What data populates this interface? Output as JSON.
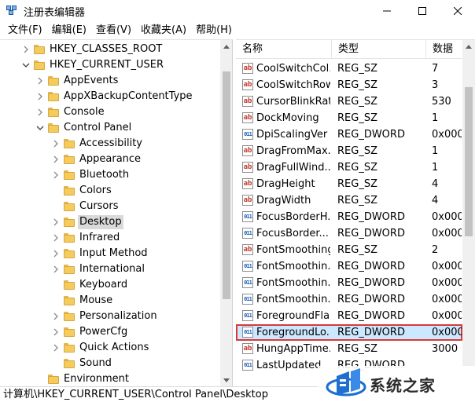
{
  "window": {
    "title": "注册表编辑器",
    "controls": [
      "minimize-icon",
      "maximize-icon",
      "close-icon"
    ]
  },
  "menu": [
    "文件(F)",
    "编辑(E)",
    "查看(V)",
    "收藏夹(A)",
    "帮助(H)"
  ],
  "tree": {
    "items": [
      {
        "label": "HKEY_CLASSES_ROOT",
        "level": 1,
        "expander": "collapsed"
      },
      {
        "label": "HKEY_CURRENT_USER",
        "level": 1,
        "expander": "expanded"
      },
      {
        "label": "AppEvents",
        "level": 2,
        "expander": "collapsed"
      },
      {
        "label": "AppXBackupContentType",
        "level": 2,
        "expander": "collapsed"
      },
      {
        "label": "Console",
        "level": 2,
        "expander": "collapsed"
      },
      {
        "label": "Control Panel",
        "level": 2,
        "expander": "expanded"
      },
      {
        "label": "Accessibility",
        "level": 3,
        "expander": "collapsed"
      },
      {
        "label": "Appearance",
        "level": 3,
        "expander": "collapsed"
      },
      {
        "label": "Bluetooth",
        "level": 3,
        "expander": "collapsed"
      },
      {
        "label": "Colors",
        "level": 3,
        "expander": "none"
      },
      {
        "label": "Cursors",
        "level": 3,
        "expander": "none"
      },
      {
        "label": "Desktop",
        "level": 3,
        "expander": "collapsed",
        "selected": true
      },
      {
        "label": "Infrared",
        "level": 3,
        "expander": "collapsed"
      },
      {
        "label": "Input Method",
        "level": 3,
        "expander": "collapsed"
      },
      {
        "label": "International",
        "level": 3,
        "expander": "collapsed"
      },
      {
        "label": "Keyboard",
        "level": 3,
        "expander": "none"
      },
      {
        "label": "Mouse",
        "level": 3,
        "expander": "none"
      },
      {
        "label": "Personalization",
        "level": 3,
        "expander": "collapsed"
      },
      {
        "label": "PowerCfg",
        "level": 3,
        "expander": "collapsed"
      },
      {
        "label": "Quick Actions",
        "level": 3,
        "expander": "collapsed"
      },
      {
        "label": "Sound",
        "level": 3,
        "expander": "none"
      },
      {
        "label": "Environment",
        "level": 2,
        "expander": "none"
      }
    ]
  },
  "list": {
    "columns": [
      "名称",
      "类型",
      "数据"
    ],
    "rows": [
      {
        "name": "CoolSwitchCol...",
        "type": "REG_SZ",
        "data": "7",
        "icon": "string-value-icon"
      },
      {
        "name": "CoolSwitchRows",
        "type": "REG_SZ",
        "data": "3",
        "icon": "string-value-icon"
      },
      {
        "name": "CursorBlinkRate",
        "type": "REG_SZ",
        "data": "530",
        "icon": "string-value-icon"
      },
      {
        "name": "DockMoving",
        "type": "REG_SZ",
        "data": "1",
        "icon": "string-value-icon"
      },
      {
        "name": "DpiScalingVer",
        "type": "REG_DWORD",
        "data": "0x000",
        "icon": "dword-value-icon"
      },
      {
        "name": "DragFromMax...",
        "type": "REG_SZ",
        "data": "1",
        "icon": "string-value-icon"
      },
      {
        "name": "DragFullWind...",
        "type": "REG_SZ",
        "data": "1",
        "icon": "string-value-icon"
      },
      {
        "name": "DragHeight",
        "type": "REG_SZ",
        "data": "4",
        "icon": "string-value-icon"
      },
      {
        "name": "DragWidth",
        "type": "REG_SZ",
        "data": "4",
        "icon": "string-value-icon"
      },
      {
        "name": "FocusBorderH...",
        "type": "REG_DWORD",
        "data": "0x000",
        "icon": "dword-value-icon"
      },
      {
        "name": "FocusBorder...",
        "type": "REG_DWORD",
        "data": "0x000",
        "icon": "dword-value-icon"
      },
      {
        "name": "FontSmoothing",
        "type": "REG_SZ",
        "data": "2",
        "icon": "string-value-icon"
      },
      {
        "name": "FontSmoothin...",
        "type": "REG_DWORD",
        "data": "0x000",
        "icon": "dword-value-icon"
      },
      {
        "name": "FontSmoothin...",
        "type": "REG_DWORD",
        "data": "0x000",
        "icon": "dword-value-icon"
      },
      {
        "name": "FontSmoothin...",
        "type": "REG_DWORD",
        "data": "0x000",
        "icon": "dword-value-icon"
      },
      {
        "name": "ForegroundFla...",
        "type": "REG_DWORD",
        "data": "0x000",
        "icon": "dword-value-icon"
      },
      {
        "name": "ForegroundLo...",
        "type": "REG_DWORD",
        "data": "0x000",
        "icon": "dword-value-icon",
        "selected": true
      },
      {
        "name": "HungAppTime...",
        "type": "REG_SZ",
        "data": "3000",
        "icon": "string-value-icon"
      },
      {
        "name": "LastUpdated",
        "type": "REG_DWORD",
        "data": "",
        "icon": "dword-value-icon"
      }
    ]
  },
  "status": {
    "path": "计算机\\HKEY_CURRENT_USER\\Control Panel\\Desktop"
  },
  "watermark": {
    "text": "系统之家"
  },
  "colors": {
    "selection_bg": "#cce8ff",
    "selection_border": "#d83a3a",
    "folder": "#f4cc5e",
    "tree_selected_bg": "#d9d9d9"
  }
}
